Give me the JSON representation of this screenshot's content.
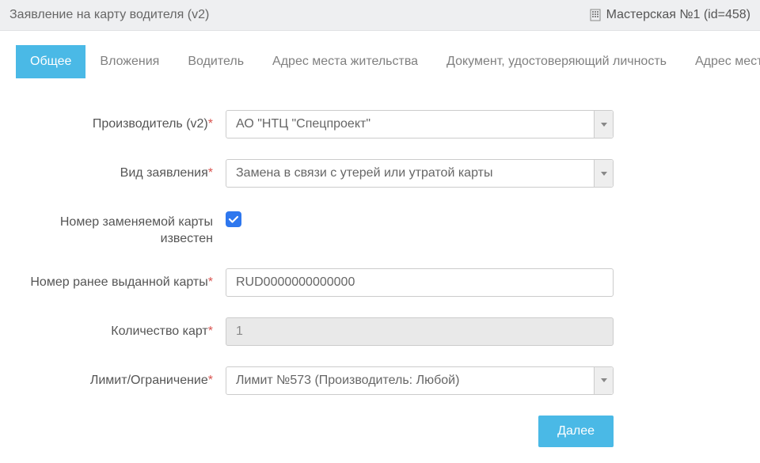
{
  "header": {
    "title": "Заявление на карту водителя (v2)",
    "workshop": "Мастерская №1 (id=458)"
  },
  "tabs": [
    {
      "label": "Общее",
      "active": true
    },
    {
      "label": "Вложения",
      "active": false
    },
    {
      "label": "Водитель",
      "active": false
    },
    {
      "label": "Адрес места жительства",
      "active": false
    },
    {
      "label": "Документ, удостоверяющий личность",
      "active": false
    },
    {
      "label": "Адрес места регистрации",
      "active": false
    }
  ],
  "form": {
    "manufacturer": {
      "label": "Производитель (v2)",
      "value": "АО \"НТЦ \"Спецпроект\"",
      "required": true
    },
    "application_type": {
      "label": "Вид заявления",
      "value": "Замена в связи с утерей или утратой карты",
      "required": true
    },
    "replaced_card_known": {
      "label": "Номер заменяемой карты известен",
      "checked": true
    },
    "previous_card_number": {
      "label": "Номер ранее выданной карты",
      "value": "RUD0000000000000",
      "required": true
    },
    "card_quantity": {
      "label": "Количество карт",
      "value": "1",
      "required": true
    },
    "limit": {
      "label": "Лимит/Ограничение",
      "value": "Лимит №573 (Производитель: Любой)",
      "required": true
    }
  },
  "buttons": {
    "next": "Далее"
  }
}
